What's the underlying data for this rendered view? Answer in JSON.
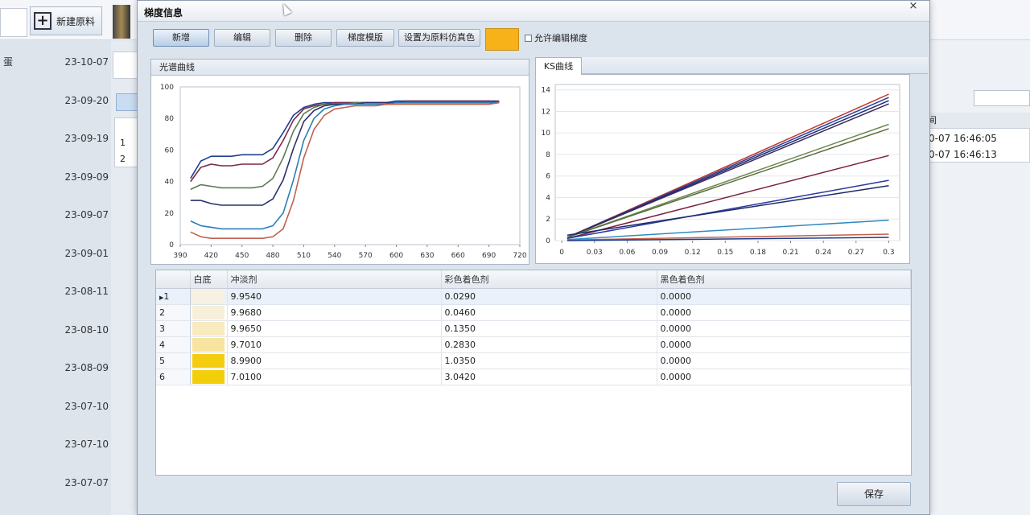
{
  "background": {
    "new_material_label": "新建原料",
    "truncated_text": "蛋",
    "dates": [
      "23-10-07",
      "23-09-20",
      "23-09-19",
      "23-09-09",
      "23-09-07",
      "23-09-01",
      "23-08-11",
      "23-08-10",
      "23-08-09",
      "23-07-10",
      "23-07-10",
      "23-07-07"
    ],
    "grid_rows": [
      "1",
      "2"
    ],
    "right_header": "间",
    "right_rows": [
      "0-07 16:46:05",
      "0-07 16:46:13"
    ]
  },
  "dialog": {
    "title": "梯度信息",
    "close": "×",
    "toolbar": {
      "add": "新增",
      "edit": "编辑",
      "delete": "删除",
      "template": "梯度模版",
      "set_simulated_color": "设置为原料仿真色",
      "swatch_color": "#f7b21a",
      "allow_edit": "允许编辑梯度"
    },
    "spectrum_panel_title": "光谱曲线",
    "ks_panel_title": "KS曲线",
    "table": {
      "columns": [
        "白底",
        "冲淡剂",
        "彩色着色剂",
        "黑色着色剂"
      ],
      "rows": [
        {
          "index": "1",
          "swatch": "#f6f1e2",
          "diluent": "9.9540",
          "colorant": "0.0290",
          "black": "0.0000"
        },
        {
          "index": "2",
          "swatch": "#f6efd9",
          "diluent": "9.9680",
          "colorant": "0.0460",
          "black": "0.0000"
        },
        {
          "index": "3",
          "swatch": "#f9eac0",
          "diluent": "9.9650",
          "colorant": "0.1350",
          "black": "0.0000"
        },
        {
          "index": "4",
          "swatch": "#f7e49f",
          "diluent": "9.7010",
          "colorant": "0.2830",
          "black": "0.0000"
        },
        {
          "index": "5",
          "swatch": "#f4cd0f",
          "diluent": "8.9900",
          "colorant": "1.0350",
          "black": "0.0000"
        },
        {
          "index": "6",
          "swatch": "#f2cf08",
          "diluent": "7.0100",
          "colorant": "3.0420",
          "black": "0.0000"
        }
      ]
    },
    "save": "保存"
  },
  "chart_data": [
    {
      "type": "line",
      "title": "光谱曲线",
      "x": [
        400,
        410,
        420,
        430,
        440,
        450,
        460,
        470,
        480,
        490,
        500,
        510,
        520,
        530,
        540,
        550,
        560,
        570,
        580,
        590,
        600,
        610,
        620,
        630,
        640,
        650,
        660,
        670,
        680,
        690,
        700
      ],
      "xticks": [
        390,
        420,
        450,
        480,
        510,
        540,
        570,
        600,
        630,
        660,
        690,
        720
      ],
      "yticks": [
        0,
        20,
        40,
        60,
        80,
        100
      ],
      "xlim": [
        390,
        720
      ],
      "ylim": [
        0,
        100
      ],
      "series": [
        {
          "color": "#1f3f8f",
          "values": [
            42,
            53,
            56,
            56,
            56,
            57,
            57,
            57,
            61,
            71,
            82,
            87,
            89,
            90,
            90,
            90,
            90,
            90,
            90,
            90,
            91,
            91,
            91,
            91,
            91,
            91,
            91,
            91,
            91,
            91,
            91
          ]
        },
        {
          "color": "#7a2a4a",
          "values": [
            40,
            49,
            51,
            50,
            50,
            51,
            51,
            51,
            55,
            66,
            79,
            86,
            88,
            89,
            90,
            90,
            90,
            90,
            90,
            90,
            90,
            91,
            91,
            91,
            91,
            91,
            91,
            91,
            91,
            91,
            90
          ]
        },
        {
          "color": "#5c7a52",
          "values": [
            35,
            38,
            37,
            36,
            36,
            36,
            36,
            37,
            42,
            55,
            72,
            83,
            87,
            89,
            89,
            89,
            90,
            90,
            90,
            90,
            90,
            90,
            90,
            90,
            90,
            90,
            90,
            90,
            90,
            90,
            90
          ]
        },
        {
          "color": "#2a2f6e",
          "values": [
            28,
            28,
            26,
            25,
            25,
            25,
            25,
            25,
            29,
            41,
            61,
            78,
            85,
            88,
            89,
            89,
            89,
            90,
            90,
            90,
            90,
            90,
            90,
            90,
            90,
            90,
            90,
            90,
            90,
            90,
            90
          ]
        },
        {
          "color": "#2a7fb8",
          "values": [
            15,
            12,
            11,
            10,
            10,
            10,
            10,
            10,
            12,
            20,
            41,
            66,
            80,
            86,
            88,
            89,
            89,
            89,
            89,
            89,
            90,
            90,
            90,
            90,
            90,
            90,
            90,
            90,
            90,
            90,
            90
          ]
        },
        {
          "color": "#c0614e",
          "values": [
            8,
            5,
            4,
            4,
            4,
            4,
            4,
            4,
            5,
            10,
            28,
            55,
            73,
            82,
            86,
            87,
            88,
            88,
            88,
            89,
            89,
            89,
            89,
            89,
            89,
            89,
            89,
            89,
            89,
            89,
            90
          ]
        }
      ]
    },
    {
      "type": "line",
      "title": "KS曲线",
      "xticks": [
        "0",
        "0.03",
        "0.06",
        "0.09",
        "0.12",
        "0.15",
        "0.18",
        "0.21",
        "0.24",
        "0.27",
        "0.3"
      ],
      "yticks": [
        0,
        2,
        4,
        6,
        8,
        10,
        12,
        14
      ],
      "xlim": [
        -0.006,
        0.31
      ],
      "ylim": [
        0,
        14.5
      ],
      "series": [
        {
          "color": "#c0392b",
          "points": [
            [
              0.005,
              0.3
            ],
            [
              0.3,
              13.6
            ]
          ]
        },
        {
          "color": "#2a3f9e",
          "points": [
            [
              0.005,
              0.3
            ],
            [
              0.3,
              13.3
            ]
          ]
        },
        {
          "color": "#1f2d6e",
          "points": [
            [
              0.005,
              0.3
            ],
            [
              0.3,
              13.0
            ]
          ]
        },
        {
          "color": "#3b2a5e",
          "points": [
            [
              0.005,
              0.3
            ],
            [
              0.3,
              12.7
            ]
          ]
        },
        {
          "color": "#6d8a4e",
          "points": [
            [
              0.005,
              0.3
            ],
            [
              0.3,
              10.8
            ]
          ]
        },
        {
          "color": "#5a6d3e",
          "points": [
            [
              0.005,
              0.3
            ],
            [
              0.3,
              10.4
            ]
          ]
        },
        {
          "color": "#7a1f3a",
          "points": [
            [
              0.005,
              0.2
            ],
            [
              0.3,
              7.9
            ]
          ]
        },
        {
          "color": "#2a3aa0",
          "points": [
            [
              0.005,
              0.2
            ],
            [
              0.3,
              5.6
            ]
          ]
        },
        {
          "color": "#1e2a6a",
          "points": [
            [
              0.005,
              0.5
            ],
            [
              0.3,
              5.1
            ]
          ]
        },
        {
          "color": "#2f8ac4",
          "points": [
            [
              0.005,
              0.1
            ],
            [
              0.3,
              1.9
            ]
          ]
        },
        {
          "color": "#c0614e",
          "points": [
            [
              0.005,
              0.05
            ],
            [
              0.3,
              0.6
            ]
          ]
        },
        {
          "color": "#1f3a8a",
          "points": [
            [
              0.005,
              0.0
            ],
            [
              0.3,
              0.3
            ]
          ]
        }
      ]
    }
  ]
}
